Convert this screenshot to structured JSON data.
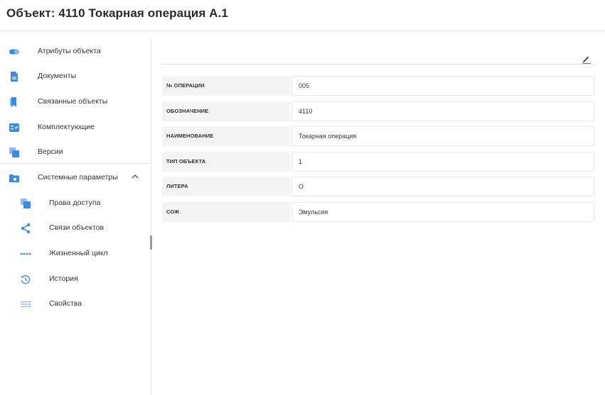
{
  "header": {
    "title": "Объект: 4110 Токарная операция А.1"
  },
  "sidebar": {
    "items": [
      {
        "label": "Атрибуты объекта",
        "icon": "pill-icon"
      },
      {
        "label": "Документы",
        "icon": "document-icon"
      },
      {
        "label": "Связанные объекты",
        "icon": "bookmark-icon"
      },
      {
        "label": "Комплектующие",
        "icon": "checklist-icon"
      },
      {
        "label": "Версии",
        "icon": "layers-icon"
      },
      {
        "label": "Системные параметры",
        "icon": "folder-icon",
        "expanded": true
      }
    ],
    "subitems": [
      {
        "label": "Права доступа",
        "icon": "layers-icon"
      },
      {
        "label": "Связи объектов",
        "icon": "share-icon"
      },
      {
        "label": "Жизненный цикл",
        "icon": "dots-line-icon"
      },
      {
        "label": "История",
        "icon": "history-icon"
      },
      {
        "label": "Свойства",
        "icon": "list-icon"
      }
    ]
  },
  "attributes": [
    {
      "key": "№ ОПЕРАЦИИ",
      "value": "005"
    },
    {
      "key": "ОБОЗНАЧЕНИЕ",
      "value": "4110"
    },
    {
      "key": "НАИМЕНОВАНИЕ",
      "value": "Токарная операция"
    },
    {
      "key": "ТИП ОБЪЕКТА",
      "value": "1"
    },
    {
      "key": "ЛИТЕРА",
      "value": "О"
    },
    {
      "key": "СОЖ",
      "value": "Эмульсия"
    }
  ],
  "colors": {
    "accent": "#2f80d1",
    "icon": "#3d8be0",
    "icon_light": "#8cbaf0"
  }
}
